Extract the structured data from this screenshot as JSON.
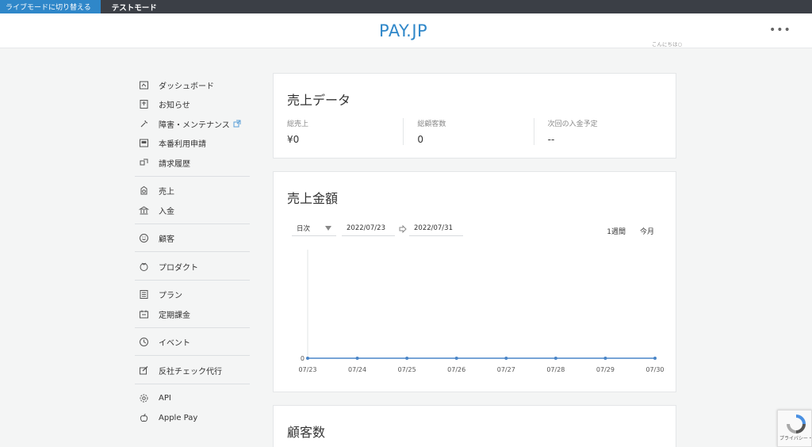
{
  "modebar": {
    "live_label": "ライブモードに切り替える",
    "test_label": "テストモード"
  },
  "header": {
    "logo_main": "PAY",
    "logo_dot": ".",
    "logo_sub": "JP",
    "greeting": "こんにちは○",
    "more_label": "•••"
  },
  "sidebar": {
    "groups": [
      [
        {
          "label": "ダッシュボード",
          "icon": "dashboard-icon"
        },
        {
          "label": "お知らせ",
          "icon": "notice-icon"
        },
        {
          "label": "障害・メンテナンス",
          "icon": "maintenance-icon",
          "external": true
        },
        {
          "label": "本番利用申請",
          "icon": "application-icon"
        },
        {
          "label": "請求履歴",
          "icon": "billing-icon"
        }
      ],
      [
        {
          "label": "売上",
          "icon": "sales-icon"
        },
        {
          "label": "入金",
          "icon": "bank-icon"
        }
      ],
      [
        {
          "label": "顧客",
          "icon": "customer-icon"
        }
      ],
      [
        {
          "label": "プロダクト",
          "icon": "product-icon"
        }
      ],
      [
        {
          "label": "プラン",
          "icon": "plan-icon"
        },
        {
          "label": "定期課金",
          "icon": "subscription-icon"
        }
      ],
      [
        {
          "label": "イベント",
          "icon": "event-icon"
        }
      ],
      [
        {
          "label": "反社チェック代行",
          "icon": "check-icon"
        }
      ],
      [
        {
          "label": "API",
          "icon": "api-icon"
        },
        {
          "label": "Apple Pay",
          "icon": "applepay-icon"
        }
      ]
    ]
  },
  "sales_data": {
    "title": "売上データ",
    "stats": [
      {
        "label": "総売上",
        "value": "¥0"
      },
      {
        "label": "総顧客数",
        "value": "0"
      },
      {
        "label": "次回の入金予定",
        "value": "--"
      }
    ]
  },
  "sales_amount": {
    "title": "売上金額",
    "interval": "日次",
    "date_from": "2022/07/23",
    "date_to": "2022/07/31",
    "range_week": "1週間",
    "range_month": "今月"
  },
  "customer_count": {
    "title": "顧客数"
  },
  "recaptcha": {
    "text": "プライバシー・利用規約"
  },
  "chart_data": {
    "type": "line",
    "categories": [
      "07/23",
      "07/24",
      "07/25",
      "07/26",
      "07/27",
      "07/28",
      "07/29",
      "07/30"
    ],
    "series": [
      {
        "values": [
          0,
          0,
          0,
          0,
          0,
          0,
          0,
          0
        ]
      }
    ],
    "yticks": [
      "0"
    ],
    "title": "",
    "xlabel": "",
    "ylabel": "",
    "line_color": "#4a86c8",
    "grid": false
  }
}
